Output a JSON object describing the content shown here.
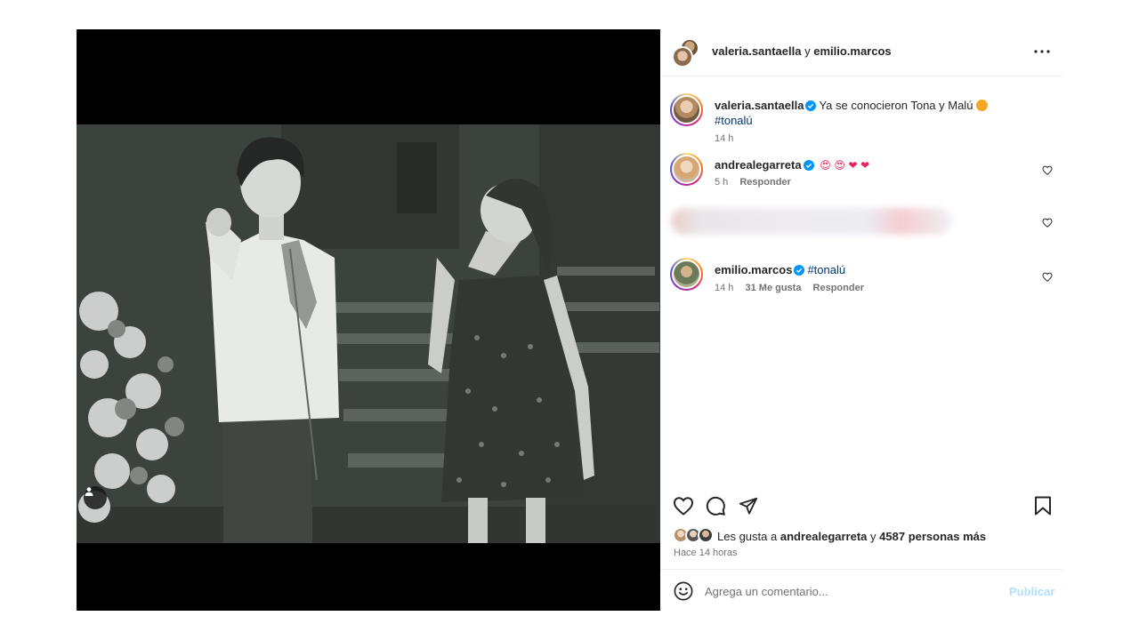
{
  "post": {
    "image_alt": "Black and white photo of a young man pointing and a young woman in a floral dress inside a church",
    "tagged_icon": "person-tag-icon"
  },
  "header": {
    "user1": "valeria.santaella",
    "conjunction": "y",
    "user2": "emilio.marcos",
    "more_icon": "more-options-icon"
  },
  "caption": {
    "username": "valeria.santaella",
    "text": "Ya se conocieron Tona y Malú",
    "emoji": "🥹",
    "hashtag": "#tonalú",
    "time": "14 h"
  },
  "comments": [
    {
      "username": "andrealegarreta",
      "emojis": [
        "😍",
        "😍",
        "❤",
        "❤"
      ],
      "time": "5 h",
      "reply": "Responder"
    },
    {
      "username": "emilio.marcos",
      "text": "#tonalú",
      "time": "14 h",
      "likes": "31 Me gusta",
      "reply": "Responder"
    }
  ],
  "actions": {
    "like_icon": "heart-icon",
    "comment_icon": "comment-icon",
    "share_icon": "share-icon",
    "save_icon": "bookmark-icon"
  },
  "likes": {
    "prefix": "Les gusta a",
    "user": "andrealegarreta",
    "mid": "y",
    "count": "4587 personas más"
  },
  "time_ago": "Hace 14 horas",
  "comment_box": {
    "placeholder": "Agrega un comentario...",
    "submit": "Publicar"
  },
  "colors": {
    "text": "#262626",
    "secondary": "#737373",
    "link": "#00376b",
    "verified": "#0095f6",
    "publish_disabled": "#b2dffc"
  }
}
